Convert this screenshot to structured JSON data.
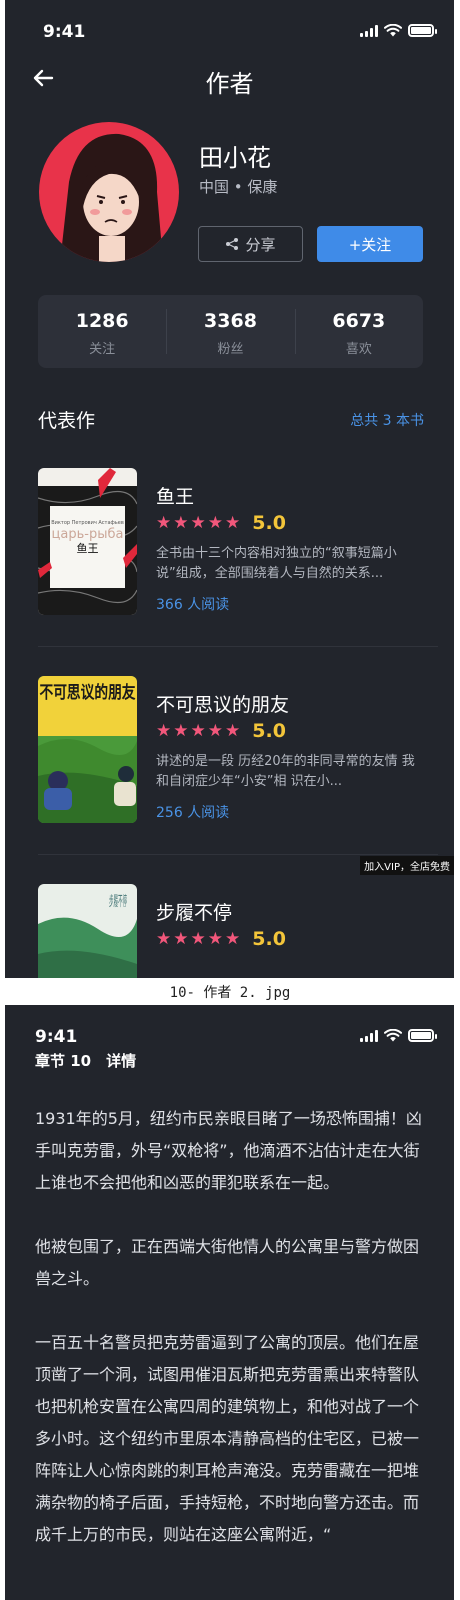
{
  "screen1": {
    "status": {
      "time": "9:41"
    },
    "nav": {
      "title": "作者",
      "back_icon": "arrow-left-icon"
    },
    "author": {
      "name": "田小花",
      "meta": "中国 • 保康",
      "share_label": "分享",
      "follow_label": "+关注"
    },
    "stats": [
      {
        "value": "1286",
        "label": "关注"
      },
      {
        "value": "3368",
        "label": "粉丝"
      },
      {
        "value": "6673",
        "label": "喜欢"
      }
    ],
    "works": {
      "title": "代表作",
      "total": "总共 3 本书",
      "books": [
        {
          "title": "鱼王",
          "score": "5.0",
          "description": "全书由十三个内容相对独立的“叙事短篇小说”组成，全部围绕着人与自然的关系...",
          "reads": "366 人阅读",
          "cover_title": "鱼王",
          "cover_overlay": "царь-рыба",
          "cover_author": "Виктор Петрович Астафьев"
        },
        {
          "title": "不可思议的朋友",
          "score": "5.0",
          "description": "讲述的是一段 历经20年的非同寻常的友情 我和自闭症少年“小安”相 识在小...",
          "reads": "256 人阅读",
          "cover_title": "不可思议的朋友"
        },
        {
          "title": "步履不停",
          "score": "5.0",
          "cover_title": "步履不停"
        }
      ]
    },
    "vip_badge": "加入VIP，全店免费"
  },
  "caption": "10- 作者 2. jpg",
  "screen2": {
    "status": {
      "time": "9:41"
    },
    "chapter_header": "章节 10　详情",
    "paragraphs": [
      "1931年的5月，纽约市民亲眼目睹了一场恐怖围捕！凶手叫克劳雷，外号“双枪将”，他滴酒不沾估计走在大街上谁也不会把他和凶恶的罪犯联系在一起。",
      "他被包围了，正在西端大街他情人的公寓里与警方做困兽之斗。",
      "一百五十名警员把克劳雷逼到了公寓的顶层。他们在屋顶凿了一个洞，试图用催泪瓦斯把克劳雷熏出来特警队也把机枪安置在公寓四周的建筑物上，和他对战了一个多小时。这个纽约市里原本清静高档的住宅区，已被一阵阵让人心惊肉跳的刺耳枪声淹没。克劳雷藏在一把堆满杂物的椅子后面，手持短枪，不时地向警方还击。而成千上万的市民，则站在这座公寓附近，“"
    ]
  },
  "colors": {
    "background": "#22252c",
    "accent_blue": "#3f8be8",
    "star_pink": "#f2577b",
    "score_yellow": "#f3c53a"
  }
}
